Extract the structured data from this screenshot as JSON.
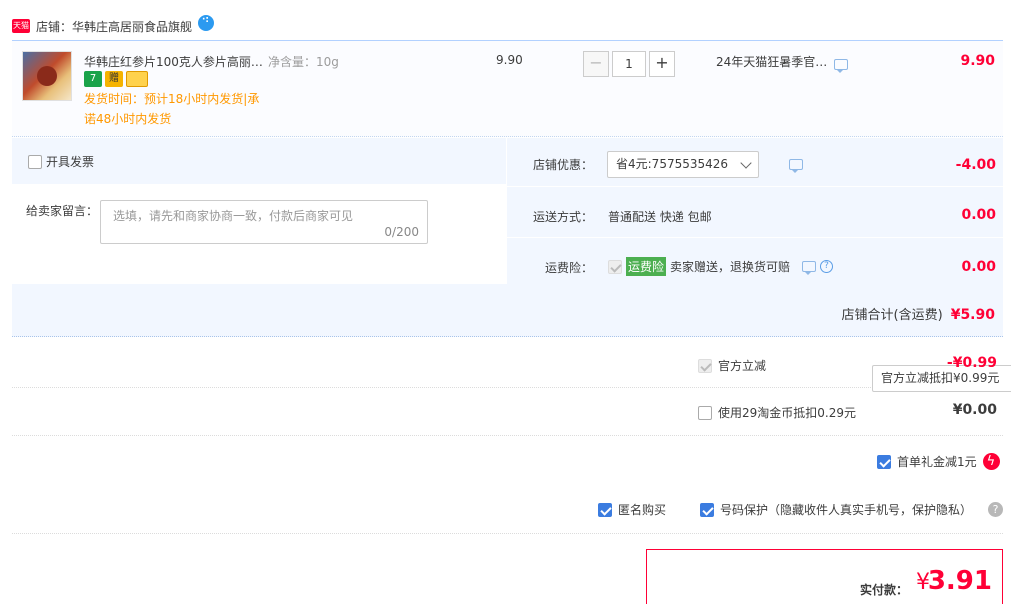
{
  "shop": {
    "badge": "天猫",
    "name": "店铺：华韩庄高居丽食品旗舰"
  },
  "item": {
    "title": "华韩庄红参片100克人参片高丽…",
    "spec": "净含量：10g",
    "tags": [
      "7",
      "赠"
    ],
    "ship_time": "发货时间：预计18小时内发货|承诺48小时内发货",
    "unit_price": "9.90",
    "qty_minus": "−",
    "qty": "1",
    "qty_plus": "+",
    "promo": "24年天猫狂暑季官…",
    "total": "9.90"
  },
  "extras": {
    "invoice_label": "开具发票",
    "msg_label": "给卖家留言：",
    "msg_placeholder": "选填，请先和商家协商一致，付款后商家可见",
    "msg_count": "0/200",
    "coupon_label": "店铺优惠：",
    "coupon_value": "省4元:7575535426",
    "coupon_amount": "-4.00",
    "delivery_label": "运送方式：",
    "delivery_value": "普通配送 快递 包邮",
    "delivery_amount": "0.00",
    "insurance_label": "运费险：",
    "insurance_tag": "运费险",
    "insurance_text": "卖家赠送，退换货可赔",
    "insurance_amount": "0.00"
  },
  "shop_total": {
    "label": "店铺合计(含运费)",
    "value": "¥5.90"
  },
  "official": {
    "label": "官方立减",
    "select": "官方立减抵扣¥0.99元",
    "value": "-¥0.99"
  },
  "coin": {
    "label": "使用29淘金币抵扣0.29元",
    "value": "¥0.00"
  },
  "gift": {
    "label": "首单礼金减1元"
  },
  "privacy": {
    "anonymous": "匿名购买",
    "number_protect": "号码保护（隐藏收件人真实手机号，保护隐私）",
    "help": "?"
  },
  "payment": {
    "label": "实付款：",
    "currency": "¥",
    "amount": "3.91"
  },
  "colors": {
    "accent": "#ff0036",
    "link_blue": "#3b7ce0",
    "orange": "#ff9800"
  }
}
